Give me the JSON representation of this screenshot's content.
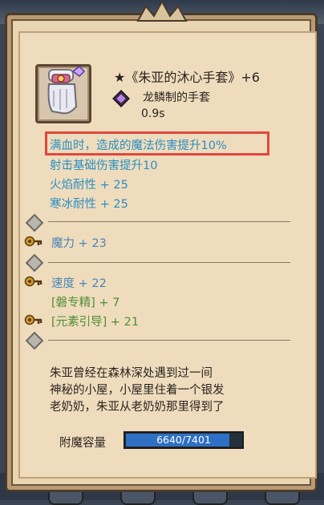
{
  "item": {
    "name": "★《朱亚的沐心手套》+6",
    "material": "龙鳞制的手套",
    "speed": "0.9s"
  },
  "effects": [
    "满血时，造成的魔法伤害提升10%",
    "射击基础伤害提升10",
    "火焰耐性 + 25",
    "寒冰耐性 + 25"
  ],
  "stats": {
    "magic": "魔力 + 23",
    "agility": "速度 + 22",
    "expertise": "[磐专精] + 7",
    "elemental": "[元素引导] + 21"
  },
  "description": [
    "朱亚曾经在森林深处遇到过一间",
    "神秘的小屋，小屋里住着一个银发",
    "老奶奶，朱亚从老奶奶那里得到了"
  ],
  "enchant": {
    "label": "附魔容量",
    "value_text": "6640/7401",
    "fraction": 0.897
  },
  "colors": {
    "highlight_border": "#e2473c",
    "effect_text": "#2a8fc2",
    "stat_blue": "#4a86b8",
    "stat_green": "#4f8e36",
    "bar_fill": "#2f6fc4"
  }
}
